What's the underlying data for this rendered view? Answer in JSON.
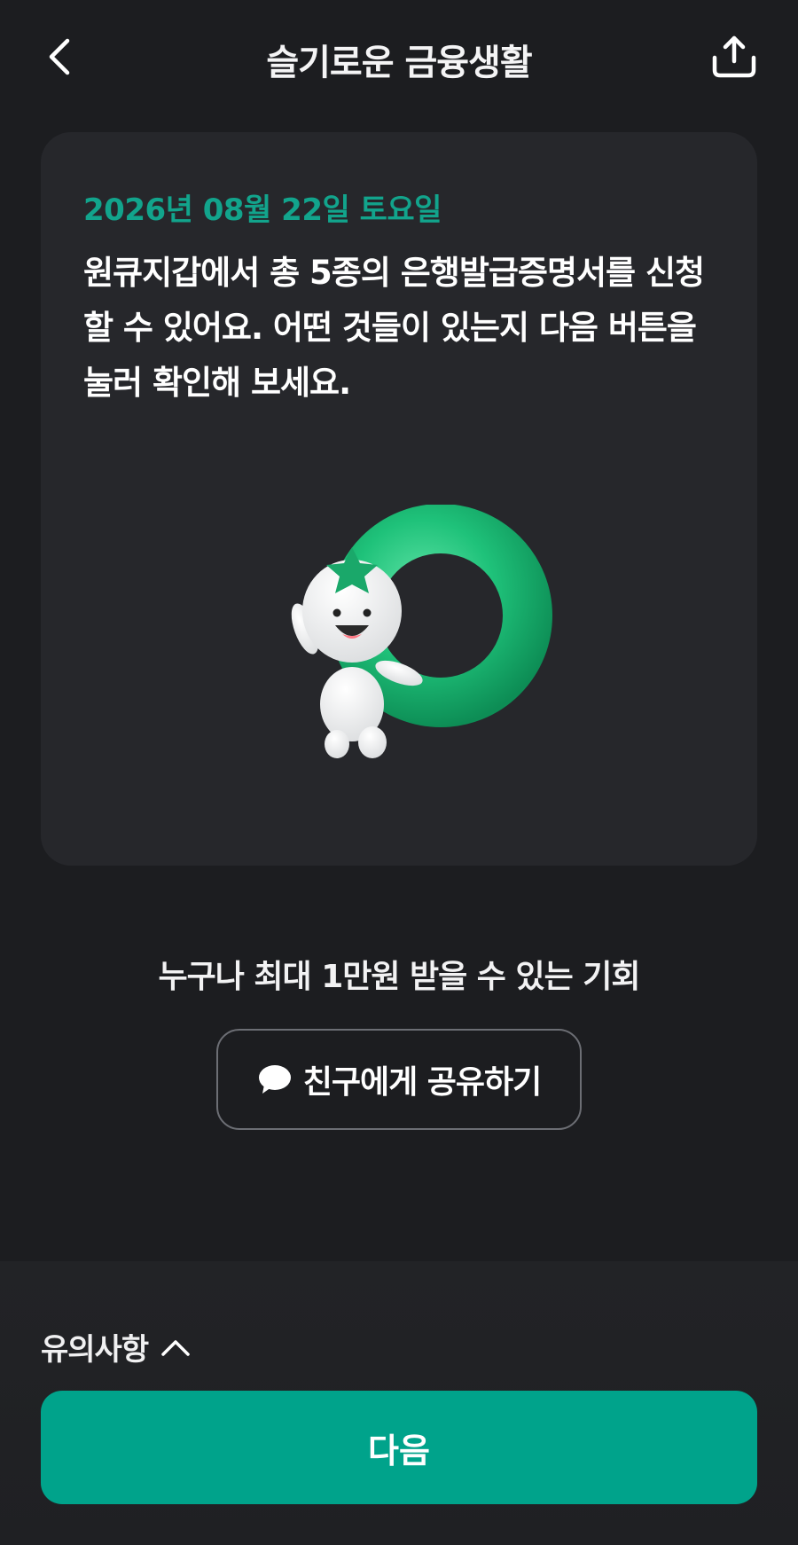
{
  "header": {
    "title": "슬기로운 금융생활",
    "back_icon": "chevron-left-icon",
    "share_icon": "share-upload-icon"
  },
  "card": {
    "date": "2026년 08월 22일 토요일",
    "body": "원큐지갑에서 총 5종의 은행발급증명서를 신청할 수 있어요. 어떤 것들이 있는지 다음 버튼을 눌러 확인해 보세요.",
    "illustration": "mascot-with-ring"
  },
  "promo": {
    "text": "누구나 최대 1만원 받을 수 있는 기회",
    "share_button_label": "친구에게 공유하기",
    "share_button_icon": "speech-bubble-icon"
  },
  "footer": {
    "notice_label": "유의사항",
    "notice_icon": "chevron-up-icon",
    "next_button_label": "다음"
  },
  "colors": {
    "background": "#1c1d20",
    "card": "#26272b",
    "accent": "#00a38b",
    "date_text": "#12a48c"
  }
}
